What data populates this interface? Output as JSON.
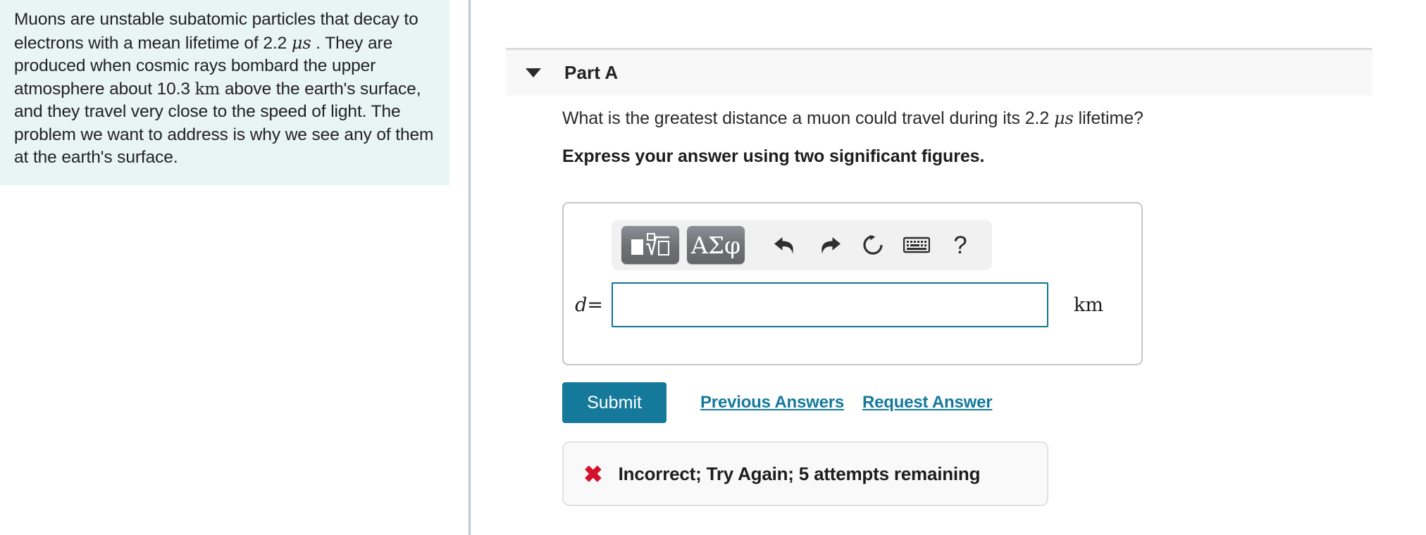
{
  "problem": {
    "text_part_1": "Muons are unstable subatomic particles that decay to electrons with a mean lifetime of 2.2 ",
    "lifetime_unit": "μs",
    "text_part_2": " . They are produced when cosmic rays bombard the upper atmosphere about 10.3 ",
    "altitude_unit": "km",
    "text_part_3": " above the earth's surface, and they travel very close to the speed of light. The problem we want to address is why we see any of them at the earth's surface.",
    "background_color": "#e8f5f4"
  },
  "part_a": {
    "title": "Part A",
    "toggle_state": "expanded",
    "question_part_1": "What is the greatest distance a muon could travel during its 2.2 ",
    "question_unit": "μs",
    "question_part_2": " lifetime?",
    "instruction": "Express your answer using two significant figures.",
    "header_background": "#f8f8f8"
  },
  "toolbar": {
    "math_template_button": "math-template",
    "greek_button_label": "ΑΣφ",
    "undo_label": "undo",
    "redo_label": "redo",
    "reset_label": "reset",
    "keyboard_label": "keyboard",
    "help_label": "?"
  },
  "answer": {
    "variable_label": "d",
    "equals_sign": "=",
    "value": "",
    "placeholder": "",
    "unit": "km",
    "border_color": "#0f7391"
  },
  "actions": {
    "submit_label": "Submit",
    "previous_answers_label": "Previous Answers",
    "request_answer_label": "Request Answer",
    "accent_color": "#15799b"
  },
  "feedback": {
    "icon": "✖",
    "icon_color": "#d5102c",
    "message": "Incorrect; Try Again; 5 attempts remaining"
  }
}
